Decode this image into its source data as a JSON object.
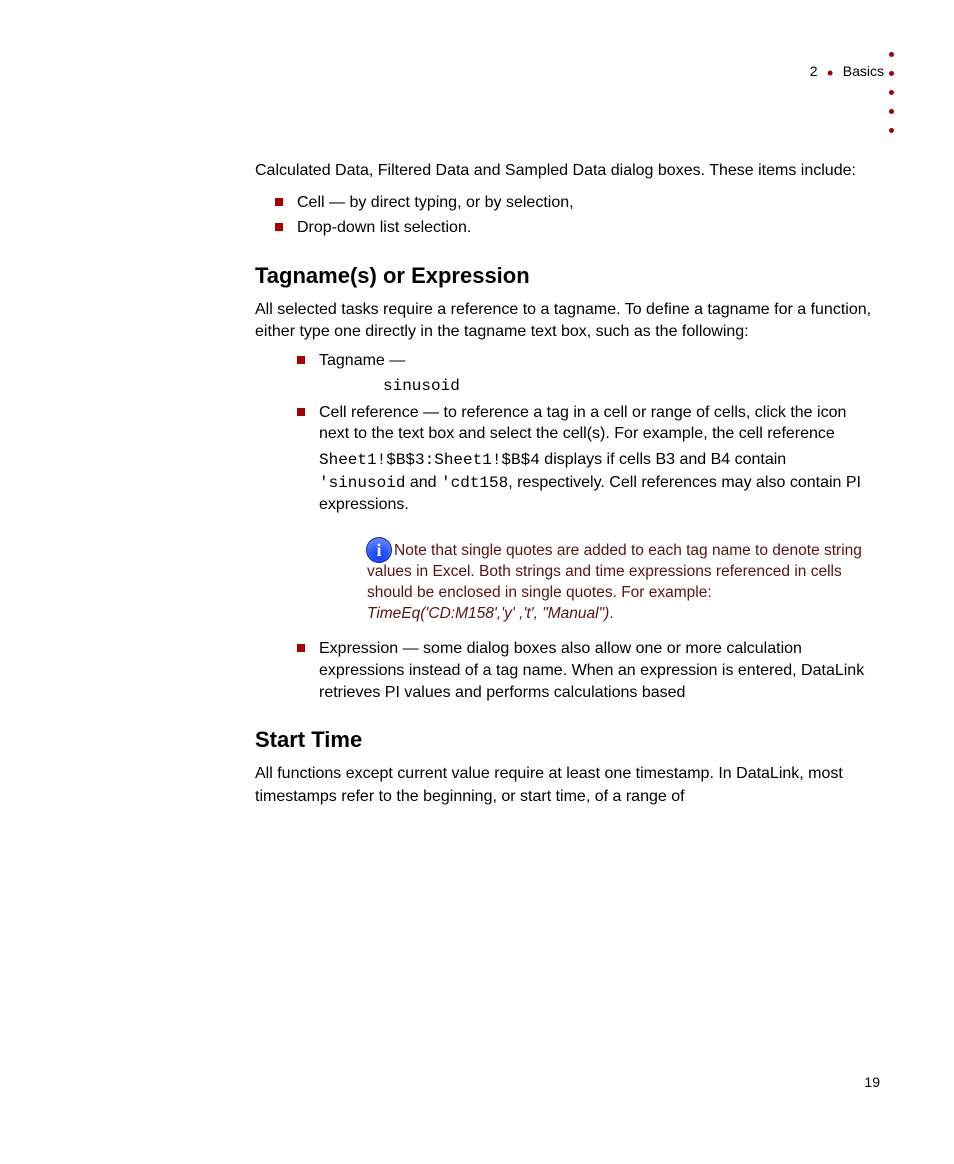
{
  "header": {
    "chapter_number": "2",
    "chapter_title": "Basics"
  },
  "intro": {
    "line1": "Calculated Data, Filtered Data and Sampled Data dialog boxes. These items include:",
    "items": [
      "Cell — by direct typing, or by selection,",
      "Drop-down list selection."
    ]
  },
  "section_tag": {
    "heading": "Tagname(s) or Expression",
    "para1": "All selected tasks require a reference to a tagname. To define a tagname for a function, either type one directly in the tagname text box, such as the following:",
    "tag_bullet1_pre": "Tagname — ",
    "tag_bullet1_code": "sinusoid",
    "tag_bullet2_pre": "Cell reference — to reference a tag in a cell or range of cells, click the icon next to the text box and select the cell(s). For example, the cell reference ",
    "tag_bullet2_code": "Sheet1!$B$3:Sheet1!$B$4",
    "tag_bullet2_mid": " displays if cells B3 and B4 contain ",
    "tag_bullet2_code2": "'sinusoid",
    "tag_bullet2_and": " and ",
    "tag_bullet2_code3": "'cdt158",
    "tag_bullet2_end": ", respectively. Cell references may also contain PI expressions.",
    "note_text": "Note that single quotes are added to each tag name to denote string values in Excel. Both strings and time expressions referenced in cells should be enclosed in single quotes. For example:",
    "note_code": "TimeEq('CD:M158','y' ,'t', \"Manual\")",
    "note_period": ".",
    "expr_bullet": "Expression — some dialog boxes also allow one or more calculation expressions instead of a tag name. When an expression is entered, DataLink retrieves PI values and performs calculations based "
  },
  "section_start": {
    "heading": "Start Time",
    "para": "All functions except current value require at least one timestamp. In DataLink, most timestamps refer to the beginning, or start time, of a range of "
  },
  "page_number": "19"
}
